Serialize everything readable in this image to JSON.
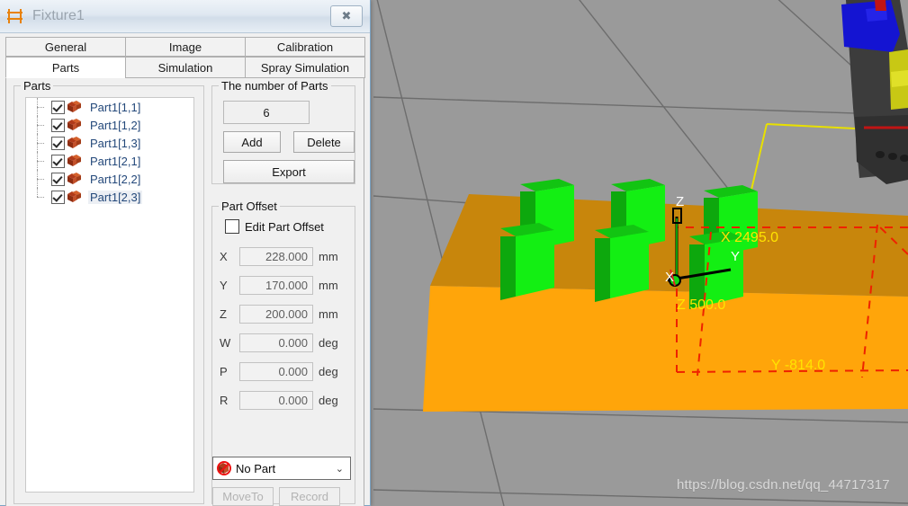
{
  "window": {
    "title": "Fixture1",
    "icon": "fixture-icon",
    "close_label": "✖"
  },
  "tabs": {
    "row1": [
      {
        "label": "General",
        "active": false
      },
      {
        "label": "Image",
        "active": false
      },
      {
        "label": "Calibration",
        "active": false
      }
    ],
    "row2": [
      {
        "label": "Parts",
        "active": true
      },
      {
        "label": "Simulation",
        "active": false
      },
      {
        "label": "Spray Simulation",
        "active": false
      }
    ]
  },
  "parts_group": {
    "legend": "Parts",
    "items": [
      {
        "label": "Part1[1,1]",
        "checked": true,
        "selected": false
      },
      {
        "label": "Part1[1,2]",
        "checked": true,
        "selected": false
      },
      {
        "label": "Part1[1,3]",
        "checked": true,
        "selected": false
      },
      {
        "label": "Part1[2,1]",
        "checked": true,
        "selected": false
      },
      {
        "label": "Part1[2,2]",
        "checked": true,
        "selected": false
      },
      {
        "label": "Part1[2,3]",
        "checked": true,
        "selected": true
      }
    ]
  },
  "number_group": {
    "legend": "The number of Parts",
    "count": "6",
    "add_label": "Add",
    "delete_label": "Delete",
    "export_label": "Export"
  },
  "offset_group": {
    "legend": "Part Offset",
    "edit_label": "Edit Part Offset",
    "edit_checked": false,
    "fields": [
      {
        "axis": "X",
        "value": "228.000",
        "unit": "mm"
      },
      {
        "axis": "Y",
        "value": "170.000",
        "unit": "mm"
      },
      {
        "axis": "Z",
        "value": "200.000",
        "unit": "mm"
      },
      {
        "axis": "W",
        "value": "0.000",
        "unit": "deg"
      },
      {
        "axis": "P",
        "value": "0.000",
        "unit": "deg"
      },
      {
        "axis": "R",
        "value": "0.000",
        "unit": "deg"
      }
    ]
  },
  "bottom": {
    "selected_part": "No Part",
    "chevron": "⌄",
    "moveto_label": "MoveTo",
    "record_label": "Record"
  },
  "viewport": {
    "axis_labels": {
      "z": "Z",
      "y": "Y",
      "x": "X"
    },
    "dimensions": {
      "x": "X 2495.0",
      "z": "Z 500.0",
      "y": "Y -814.0"
    },
    "watermark": "https://blog.csdn.net/qq_44717317",
    "colors": {
      "floor": "#9a9a9a",
      "grid_line": "#6d6d6d",
      "table_top": "#c8860c",
      "table_front": "#ffa50a",
      "part_front": "#13ef13",
      "part_top": "#12c412",
      "part_side": "#0da80d",
      "boundary_yellow": "#e8e000",
      "boundary_red": "#ee2200",
      "robot_blue": "#1414d2",
      "robot_yellow": "#c8c814",
      "robot_dark": "#3c3c3c"
    }
  }
}
